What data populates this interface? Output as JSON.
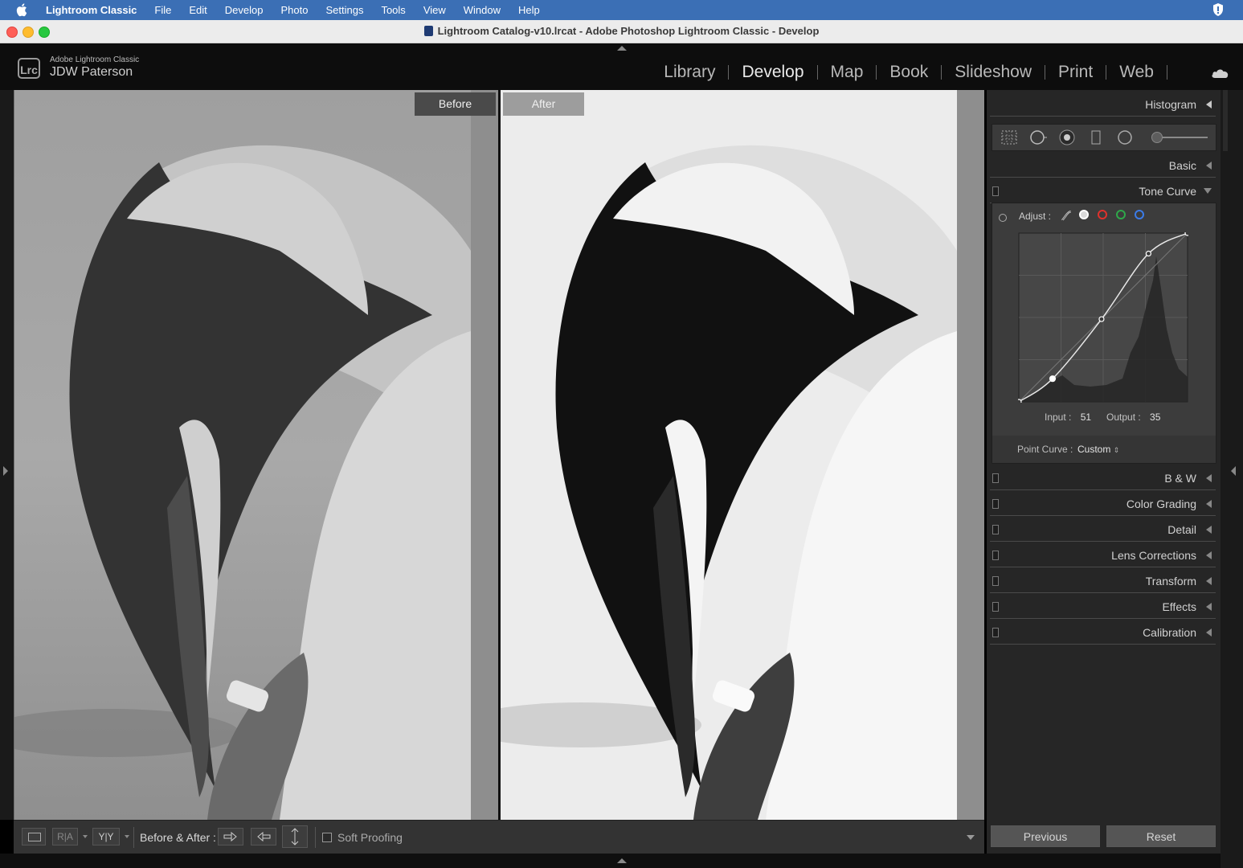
{
  "macos": {
    "menus": [
      "Lightroom Classic",
      "File",
      "Edit",
      "Develop",
      "Photo",
      "Settings",
      "Tools",
      "View",
      "Window",
      "Help"
    ]
  },
  "window": {
    "title": "Lightroom Catalog-v10.lrcat - Adobe Photoshop Lightroom Classic - Develop"
  },
  "identity": {
    "badge": "Lrc",
    "product": "Adobe Lightroom Classic",
    "user": "JDW Paterson"
  },
  "modules": [
    "Library",
    "Develop",
    "Map",
    "Book",
    "Slideshow",
    "Print",
    "Web"
  ],
  "active_module": "Develop",
  "view": {
    "before_label": "Before",
    "after_label": "After"
  },
  "toolbar": {
    "ra_label": "R|A",
    "yy_label": "Y|Y",
    "before_after_label": "Before & After :",
    "soft_proofing_label": "Soft Proofing",
    "soft_proofing_checked": false
  },
  "panels": {
    "histogram": "Histogram",
    "basic": "Basic",
    "tone_curve": "Tone Curve",
    "bw": "B & W",
    "color_grading": "Color Grading",
    "detail": "Detail",
    "lens_corrections": "Lens Corrections",
    "transform": "Transform",
    "effects": "Effects",
    "calibration": "Calibration"
  },
  "tone_curve": {
    "adjust_label": "Adjust :",
    "input_label": "Input :",
    "input_value": "51",
    "output_label": "Output :",
    "output_value": "35",
    "point_curve_label": "Point Curve :",
    "point_curve_value": "Custom",
    "channel_colors": [
      "#d9d9d9",
      "#e0312c",
      "#2fa84a",
      "#3b7be8"
    ],
    "curve_points": [
      [
        0,
        0
      ],
      [
        51,
        35
      ],
      [
        125,
        125
      ],
      [
        196,
        224
      ],
      [
        255,
        255
      ]
    ]
  },
  "buttons": {
    "previous": "Previous",
    "reset": "Reset"
  }
}
